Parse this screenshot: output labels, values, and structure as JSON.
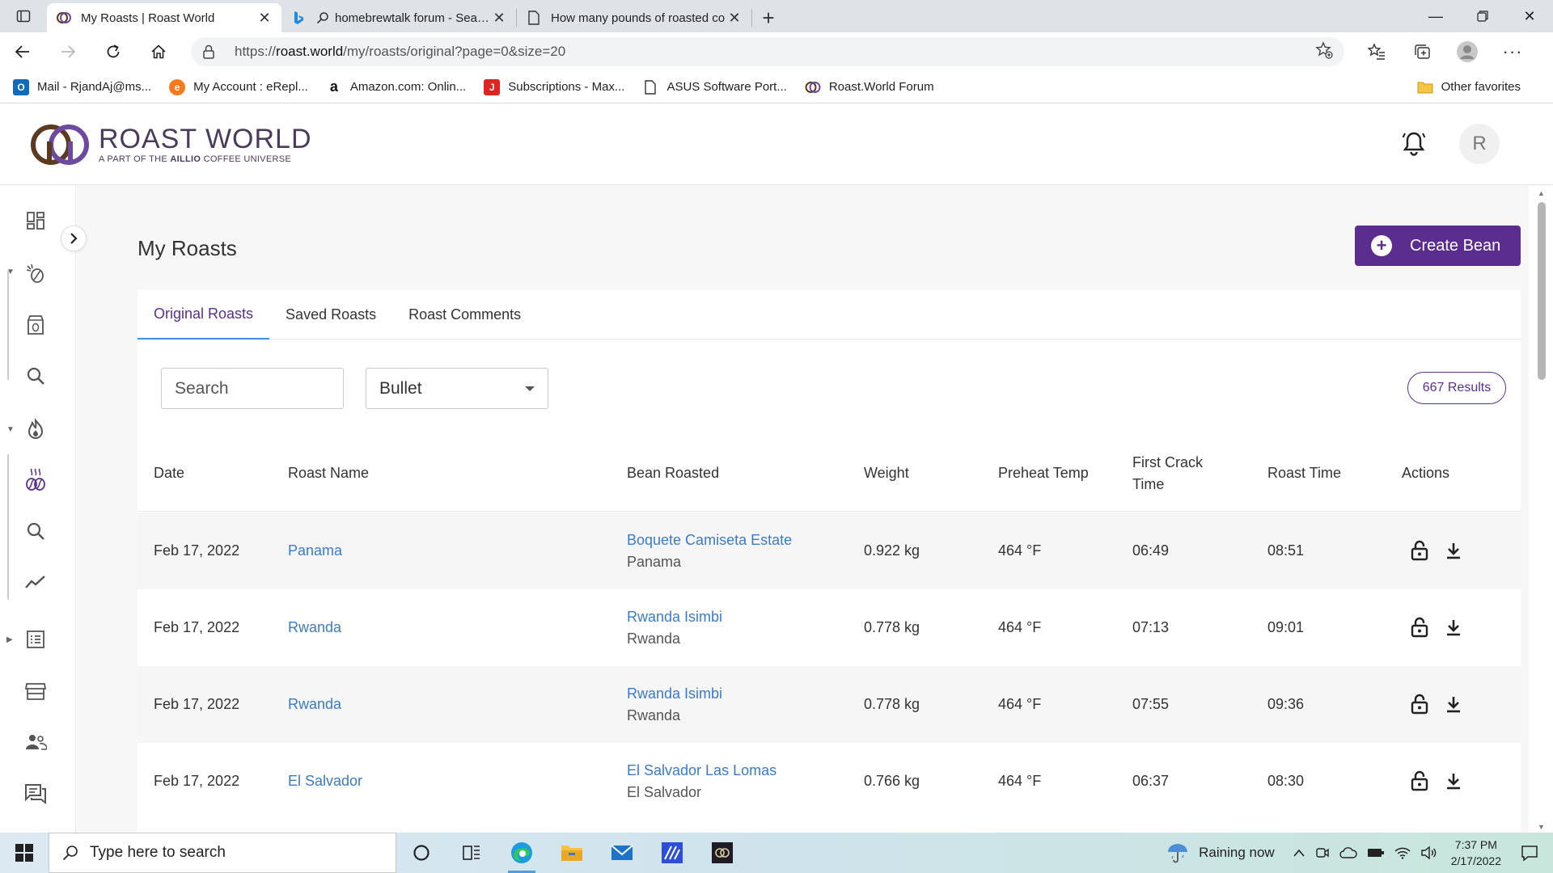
{
  "browser": {
    "tabs": [
      {
        "title": "My Roasts | Roast World",
        "active": true
      },
      {
        "title": "homebrewtalk forum - Search",
        "active": false
      },
      {
        "title": "How many pounds of roasted co",
        "active": false
      }
    ],
    "url_prefix": "https://",
    "url_host": "roast.world",
    "url_path": "/my/roasts/original?page=0&size=20",
    "favorites": [
      {
        "label": "Mail - RjandAj@ms...",
        "icon": "outlook-icon",
        "color": "#0f6cbd",
        "glyph": "O"
      },
      {
        "label": "My Account : eRepl...",
        "icon": "ereplacement-icon",
        "color": "#f47b20",
        "glyph": "e"
      },
      {
        "label": "Amazon.com: Onlin...",
        "icon": "amazon-icon",
        "color": "#ffffff",
        "glyph": "a"
      },
      {
        "label": "Subscriptions - Max...",
        "icon": "maxwell-icon",
        "color": "#e02424",
        "glyph": "J"
      },
      {
        "label": "ASUS Software Port...",
        "icon": "page-icon",
        "color": "#ffffff",
        "glyph": ""
      },
      {
        "label": "Roast.World Forum",
        "icon": "roastworld-icon",
        "color": "#ffffff",
        "glyph": ""
      }
    ],
    "other_favorites": "Other favorites"
  },
  "site": {
    "logo_name": "ROAST WORLD",
    "logo_tag_pre": "A PART OF THE ",
    "logo_tag_brand": "AILLIO",
    "logo_tag_post": " COFFEE UNIVERSE",
    "avatar_letter": "R"
  },
  "page": {
    "title": "My Roasts",
    "create_button": "Create Bean",
    "tabs": [
      "Original Roasts",
      "Saved Roasts",
      "Roast Comments"
    ],
    "search_placeholder": "Search",
    "filter_value": "Bullet",
    "results": "667 Results",
    "columns": [
      "Date",
      "Roast Name",
      "Bean Roasted",
      "Weight",
      "Preheat Temp",
      "First Crack Time",
      "Roast Time",
      "Actions"
    ],
    "rows": [
      {
        "date": "Feb 17, 2022",
        "name": "Panama",
        "bean": "Boquete Camiseta Estate",
        "origin": "Panama",
        "weight": "0.922 kg",
        "preheat": "464 °F",
        "first_crack": "06:49",
        "roast_time": "08:51"
      },
      {
        "date": "Feb 17, 2022",
        "name": "Rwanda",
        "bean": "Rwanda Isimbi",
        "origin": "Rwanda",
        "weight": "0.778 kg",
        "preheat": "464 °F",
        "first_crack": "07:13",
        "roast_time": "09:01"
      },
      {
        "date": "Feb 17, 2022",
        "name": "Rwanda",
        "bean": "Rwanda Isimbi",
        "origin": "Rwanda",
        "weight": "0.778 kg",
        "preheat": "464 °F",
        "first_crack": "07:55",
        "roast_time": "09:36"
      },
      {
        "date": "Feb 17, 2022",
        "name": "El Salvador",
        "bean": "El Salvador Las Lomas",
        "origin": "El Salvador",
        "weight": "0.766 kg",
        "preheat": "464 °F",
        "first_crack": "06:37",
        "roast_time": "08:30"
      }
    ]
  },
  "taskbar": {
    "search_placeholder": "Type here to search",
    "weather": "Raining now",
    "time": "7:37 PM",
    "date": "2/17/2022"
  },
  "colors": {
    "brand_purple": "#5b2d8e",
    "link_blue": "#3a7bc8",
    "tab_underline": "#3d8ee6"
  }
}
